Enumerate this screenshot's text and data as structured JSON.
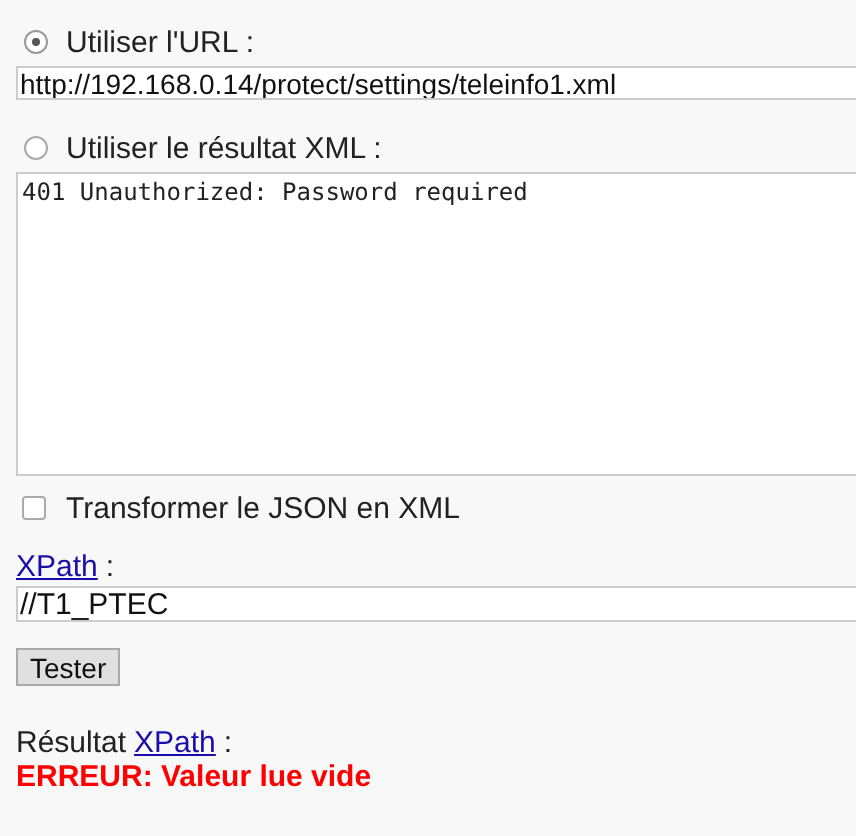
{
  "url_option": {
    "label": "Utiliser l'URL :",
    "selected": true
  },
  "url_field": {
    "value": "http://192.168.0.14/protect/settings/teleinfo1.xml"
  },
  "xml_option": {
    "label": "Utiliser le résultat XML :",
    "selected": false
  },
  "xml_result": {
    "value": "401 Unauthorized: Password required"
  },
  "transform_checkbox": {
    "label": "Transformer le JSON en XML",
    "checked": false
  },
  "xpath": {
    "link": "XPath",
    "suffix": ":",
    "value": "//T1_PTEC"
  },
  "test_button": "Tester",
  "result": {
    "label": "Résultat",
    "link": "XPath",
    "suffix": ":",
    "error": "ERREUR: Valeur lue vide"
  }
}
